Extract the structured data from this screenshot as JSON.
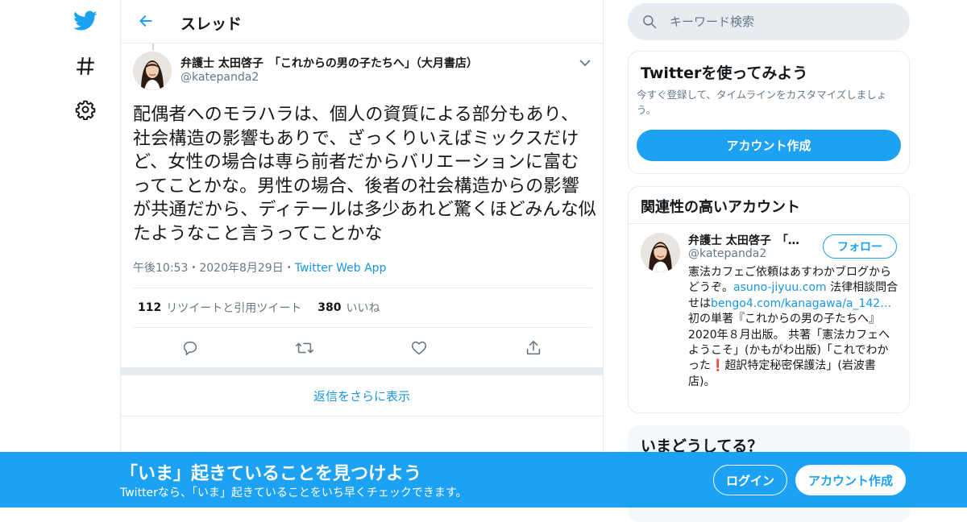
{
  "nav": {
    "logo_icon": "twitter-bird-icon",
    "explore_icon": "hashtag-icon",
    "settings_icon": "gear-icon"
  },
  "header": {
    "title": "スレッド",
    "back_icon": "back-arrow-icon"
  },
  "tweet": {
    "author_name": "弁護士 太田啓子　「これからの男の子たちへ」（大月書店）",
    "author_handle": "@katepanda2",
    "text": "配偶者へのモラハラは、個人の資質による部分もあり、社会構造の影響もありで、ざっくりいえばミックスだけど、女性の場合は専ら前者だからバリエーションに富むってことかな。男性の場合、後者の社会構造からの影響が共通だから、ディテールは多少あれど驚くほどみんな似たようなこと言うってことかな",
    "time": "午後10:53",
    "dot1": "・",
    "date": "2020年8月29日",
    "dot2": "・",
    "app": "Twitter Web App",
    "retweets_count": "112",
    "retweets_label": "リツイートと引用ツイート",
    "likes_count": "380",
    "likes_label": "いいね"
  },
  "more_replies": "返信をさらに表示",
  "search": {
    "placeholder": "キーワード検索"
  },
  "signup_card": {
    "title": "Twitterを使ってみよう",
    "description": "今すぐ登録して、タイムラインをカスタマイズしましょう。",
    "button": "アカウント作成"
  },
  "related_card": {
    "title": "関連性の高いアカウント",
    "name": "弁護士 太田啓子　「…",
    "handle": "@katepanda2",
    "follow_button": "フォロー",
    "bio_part1": "憲法カフェご依頼はあすわかブログからどうぞ。",
    "bio_link1": "asuno-jiyuu.com",
    "bio_part2": " 法律相談問合せは",
    "bio_link2": "bengo4.com/kanagawa/a_142…",
    "bio_part3": " 初の単著『これからの男の子たちへ』2020年８月出版。 共著「憲法カフェへようこそ」(かもがわ出版)「これでわかった",
    "bio_mark": "❗",
    "bio_part4": "超訳特定秘密保護法」(岩波書店)。"
  },
  "trends_card": {
    "title": "いまどうしてる？"
  },
  "banner": {
    "title": "「いま」起きていることを見つけよう",
    "subtitle": "Twitterなら、「いま」起きていることをいち早くチェックできます。",
    "login": "ログイン",
    "signup": "アカウント作成"
  }
}
